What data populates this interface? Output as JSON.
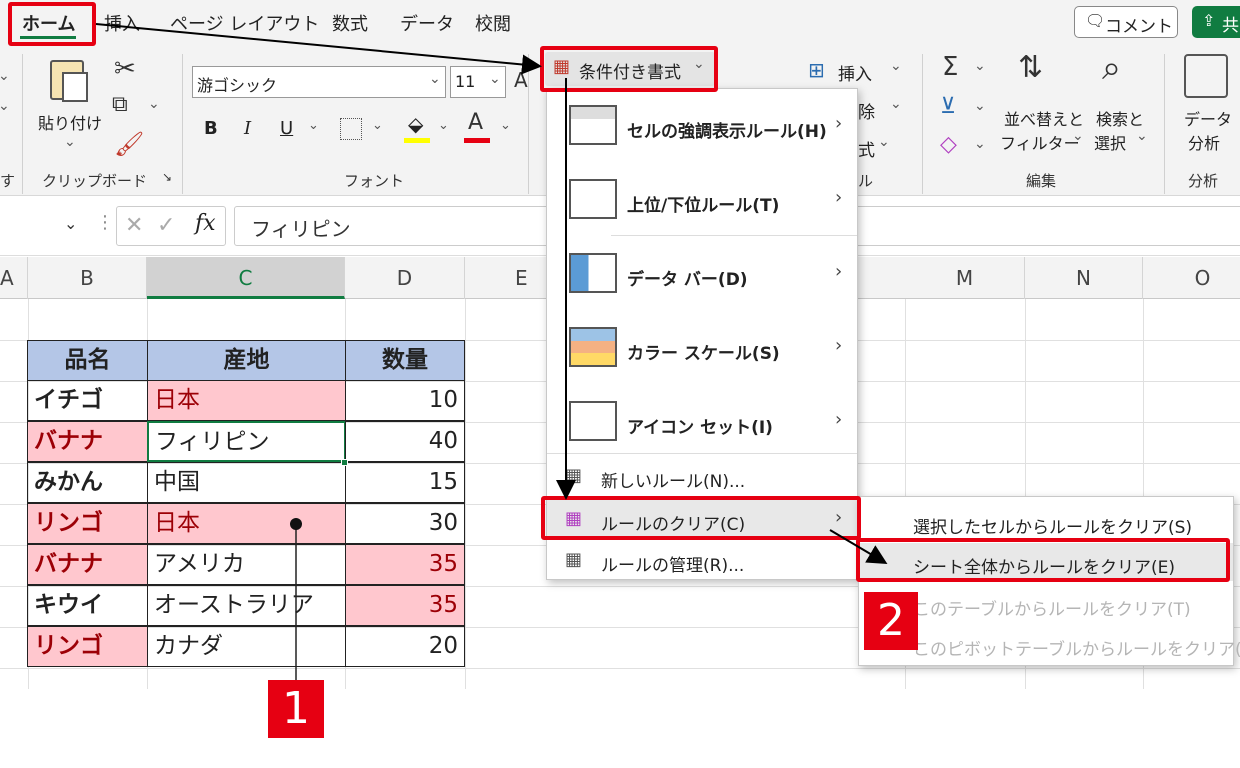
{
  "tabs": [
    "ホーム",
    "挿入",
    "ページ レイアウト",
    "数式",
    "データ",
    "校閲"
  ],
  "comment_button": "コメント",
  "share_button": "共",
  "clipboard": {
    "paste": "貼り付け",
    "group": "クリップボード",
    "launcher": "↘",
    "left_cut": "す"
  },
  "font": {
    "name": "游ゴシック",
    "size": "11",
    "bold": "B",
    "italic": "I",
    "underline": "U",
    "group": "フォント",
    "color_a": "A"
  },
  "cond_format": "条件付き書式",
  "cells_group": {
    "insert": "挿入",
    "delete_partial": "除",
    "format_partial": "式",
    "group_partial": "ル"
  },
  "editing": {
    "sort": "並べ替えと",
    "sort2": "フィルター",
    "find": "検索と",
    "find2": "選択",
    "group": "編集"
  },
  "analysis": {
    "label1": "データ",
    "label2": "分析",
    "group": "分析"
  },
  "formula_bar": {
    "value": "フィリピン",
    "fx": "fx"
  },
  "columns": [
    "A",
    "B",
    "C",
    "D",
    "E",
    "M",
    "N",
    "O"
  ],
  "table": {
    "headers": [
      "品名",
      "産地",
      "数量"
    ],
    "rows": [
      {
        "name": "イチゴ",
        "origin": "日本",
        "qty": "10"
      },
      {
        "name": "バナナ",
        "origin": "フィリピン",
        "qty": "40"
      },
      {
        "name": "みかん",
        "origin": "中国",
        "qty": "15"
      },
      {
        "name": "リンゴ",
        "origin": "日本",
        "qty": "30"
      },
      {
        "name": "バナナ",
        "origin": "アメリカ",
        "qty": "35"
      },
      {
        "name": "キウイ",
        "origin": "オーストラリア",
        "qty": "35"
      },
      {
        "name": "リンゴ",
        "origin": "カナダ",
        "qty": "20"
      }
    ]
  },
  "cf_menu": {
    "highlight": "セルの強調表示ルール(H)",
    "topbottom": "上位/下位ルール(T)",
    "databar": "データ バー(D)",
    "colorscale": "カラー スケール(S)",
    "iconset": "アイコン セット(I)",
    "newrule": "新しいルール(N)...",
    "clear": "ルールのクリア(C)",
    "manage": "ルールの管理(R)..."
  },
  "clear_submenu": {
    "selected": "選択したセルからルールをクリア(S)",
    "sheet": "シート全体からルールをクリア(E)",
    "table": "このテーブルからルールをクリア(T)",
    "pivot": "このピボットテーブルからルールをクリア(P)"
  },
  "callouts": {
    "one": "1",
    "two": "2"
  },
  "colors": {
    "accent_red": "#e60012",
    "header_blue": "#b4c6e7",
    "pink_fill": "#ffc7ce",
    "dark_red_text": "#9c0006",
    "excel_green": "#107c41"
  }
}
